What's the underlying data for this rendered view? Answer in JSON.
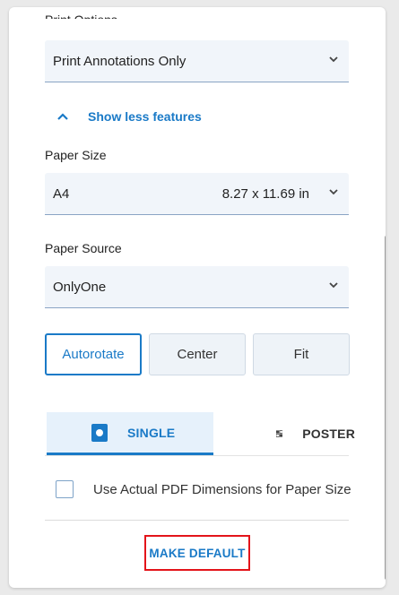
{
  "print_options": {
    "label": "Print Options",
    "value": "Print Annotations Only"
  },
  "features_toggle": {
    "label": "Show less features"
  },
  "paper_size": {
    "label": "Paper Size",
    "value": "A4",
    "dimensions": "8.27 x 11.69 in"
  },
  "paper_source": {
    "label": "Paper Source",
    "value": "OnlyOne"
  },
  "scaling": {
    "options": [
      "Autorotate",
      "Center",
      "Fit"
    ],
    "selected": "Autorotate"
  },
  "page_mode": {
    "tabs": [
      "SINGLE",
      "POSTER"
    ],
    "selected": "SINGLE"
  },
  "pdf_dimensions_checkbox": {
    "label": "Use Actual PDF Dimensions for Paper Size",
    "checked": false
  },
  "make_default": {
    "label": "MAKE DEFAULT"
  },
  "colors": {
    "accent": "#1a7ac7",
    "highlight_border": "#e3141a",
    "field_bg": "#f1f5fa"
  },
  "icons": [
    "chevron-down-icon",
    "chevron-up-icon",
    "single-page-icon",
    "poster-icon"
  ]
}
